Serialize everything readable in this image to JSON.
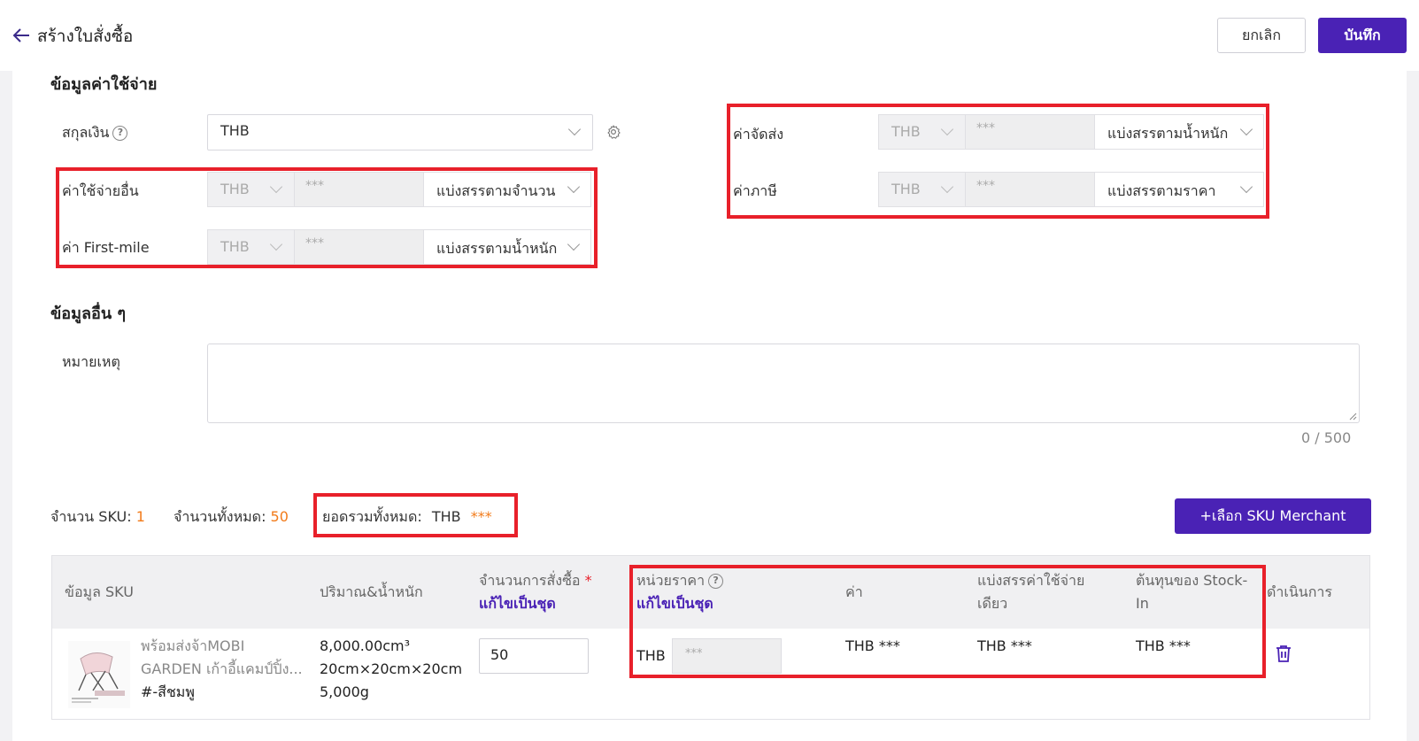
{
  "header": {
    "title": "สร้างใบสั่งซื้อ",
    "cancel_label": "ยกเลิก",
    "save_label": "บันทึก"
  },
  "costs": {
    "section_title": "ข้อมูลค่าใช้จ่าย",
    "currency_label": "สกุลเงิน",
    "currency_value": "THB",
    "other_label": "ค่าใช้จ่ายอื่น",
    "other_currency": "THB",
    "other_amount": "***",
    "other_method": "แบ่งสรรตามจำนวน",
    "firstmile_label": "ค่า First-mile",
    "firstmile_currency": "THB",
    "firstmile_amount": "***",
    "firstmile_method": "แบ่งสรรตามน้ำหนัก",
    "shipping_label": "ค่าจัดส่ง",
    "shipping_currency": "THB",
    "shipping_amount": "***",
    "shipping_method": "แบ่งสรรตามน้ำหนัก",
    "tax_label": "ค่าภาษี",
    "tax_currency": "THB",
    "tax_amount": "***",
    "tax_method": "แบ่งสรรตามราคา"
  },
  "other": {
    "section_title": "ข้อมูลอื่น ๆ",
    "remark_label": "หมายเหตุ",
    "counter": "0 / 500"
  },
  "summary": {
    "sku_count_label": "จำนวน SKU:",
    "sku_count": "1",
    "total_qty_label": "จำนวนทั้งหมด:",
    "total_qty": "50",
    "grand_total_label": "ยอดรวมทั้งหมด:",
    "grand_total_currency": "THB",
    "grand_total_value": "***",
    "select_sku_label": "+เลือก SKU Merchant"
  },
  "table": {
    "headers": {
      "sku_info": "ข้อมูล SKU",
      "volume_weight": "ปริมาณ&น้ำหนัก",
      "order_qty": "จำนวนการสั่งซื้อ",
      "order_qty_req": "*",
      "batch_edit": "แก้ไขเป็นชุด",
      "unit_price": "หน่วยราคา",
      "unit_price_batch": "แก้ไขเป็นชุด",
      "value": "ค่า",
      "alloc_line1": "แบ่งสรรค่าใช้จ่าย",
      "alloc_line2": "เดียว",
      "stockin_line1": "ต้นทุนของ Stock-",
      "stockin_line2": "In",
      "actions": "ดำเนินการ"
    },
    "row": {
      "name_line1": "พร้อมส่งจ้าMOBI",
      "name_line2": "GARDEN เก้าอี้แคมป์ปิ้ง...",
      "variant": "#-สีชมพู",
      "volume": "8,000.00cm³",
      "dimensions": "20cm×20cm×20cm",
      "weight": "5,000g",
      "qty": "50",
      "unit_currency": "THB",
      "unit_price": "***",
      "value": "THB ***",
      "alloc": "THB ***",
      "stockin_cost": "THB ***"
    }
  },
  "colors": {
    "accent": "#4a22b5",
    "highlight": "#e8202a",
    "orange": "#f27b1a"
  }
}
